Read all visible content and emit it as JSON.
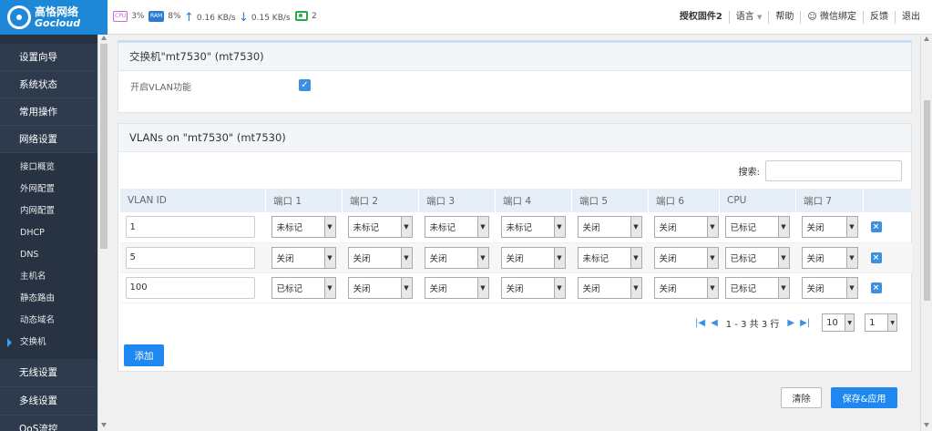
{
  "brand": {
    "name_cn": "高恪网络",
    "name_en": "Gocloud"
  },
  "stats": {
    "cpu_chip": "CPU",
    "cpu": "3%",
    "ram_chip": "RAM",
    "ram": "8%",
    "upload": "0.16 KB/s",
    "download": "0.15 KB/s",
    "devices": "2"
  },
  "topmenu": {
    "license": "授权固件2",
    "language": "语言",
    "help": "帮助",
    "wechat": "微信绑定",
    "feedback": "反馈",
    "logout": "退出"
  },
  "sidebar": {
    "top_items": [
      "设置向导",
      "系统状态",
      "常用操作",
      "网络设置"
    ],
    "sub_items": [
      "接口概览",
      "外网配置",
      "内网配置",
      "DHCP",
      "DNS",
      "主机名",
      "静态路由",
      "动态域名",
      "交换机"
    ],
    "bottom_items": [
      "无线设置",
      "多线设置",
      "QoS流控"
    ]
  },
  "switch_panel": {
    "title": "交换机\"mt7530\" (mt7530)",
    "enable_vlan_label": "开启VLAN功能"
  },
  "vlan_panel": {
    "title": "VLANs on \"mt7530\" (mt7530)",
    "search_label": "搜索:",
    "columns": [
      "VLAN ID",
      "端口 1",
      "端口 2",
      "端口 3",
      "端口 4",
      "端口 5",
      "端口 6",
      "CPU",
      "端口 7"
    ],
    "rows": [
      {
        "id": "1",
        "ports": [
          "未标记",
          "未标记",
          "未标记",
          "未标记",
          "关闭",
          "关闭",
          "已标记",
          "关闭"
        ]
      },
      {
        "id": "5",
        "ports": [
          "关闭",
          "关闭",
          "关闭",
          "关闭",
          "未标记",
          "关闭",
          "已标记",
          "关闭"
        ]
      },
      {
        "id": "100",
        "ports": [
          "已标记",
          "关闭",
          "关闭",
          "关闭",
          "关闭",
          "关闭",
          "已标记",
          "关闭"
        ]
      }
    ],
    "pager_text": "1 - 3 共 3 行",
    "page_size": "10",
    "page": "1",
    "add_label": "添加"
  },
  "footer": {
    "clear_label": "清除",
    "save_label": "保存&应用"
  },
  "colors": {
    "accent": "#1e88f0",
    "sidebar": "#273343"
  }
}
